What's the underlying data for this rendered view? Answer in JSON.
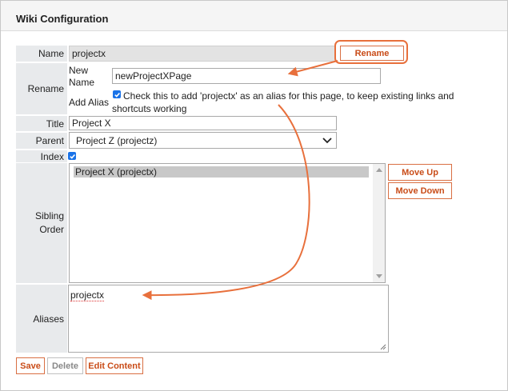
{
  "panel": {
    "title": "Wiki Configuration"
  },
  "form": {
    "name": {
      "label": "Name",
      "value": "projectx",
      "rename_button": "Rename"
    },
    "rename": {
      "label": "Rename",
      "new_name_label": "New Name",
      "new_name_value": "newProjectXPage",
      "add_alias_label": "Add Alias",
      "add_alias_checked": true,
      "add_alias_text": "Check this to add 'projectx' as an alias for this page, to keep existing links and shortcuts working"
    },
    "title": {
      "label": "Title",
      "value": "Project X"
    },
    "parent": {
      "label": "Parent",
      "selected": "Project Z (projectz)"
    },
    "index": {
      "label": "Index",
      "checked": true
    },
    "sibling_order": {
      "label": "Sibling Order",
      "items": [
        "Project X (projectx)"
      ],
      "move_up": "Move Up",
      "move_down": "Move Down"
    },
    "aliases": {
      "label": "Aliases",
      "value": "projectx"
    }
  },
  "actions": {
    "save": "Save",
    "delete": "Delete",
    "edit_content": "Edit Content"
  },
  "colors": {
    "accent": "#d96f43",
    "label_bg": "#e8eaec",
    "checkbox": "#1a73e8"
  }
}
